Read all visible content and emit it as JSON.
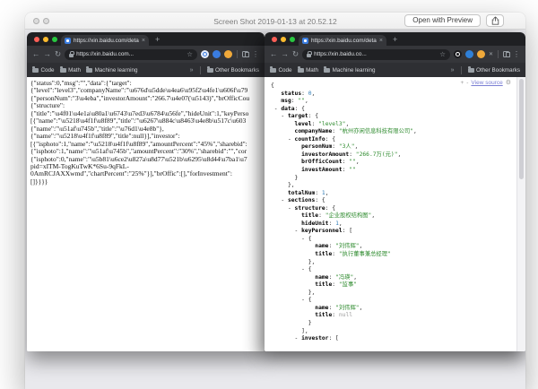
{
  "colors": {
    "traffic_red": "#ff5f57",
    "traffic_yellow": "#febc2e",
    "traffic_green": "#28c840",
    "viewer_string": "#2e8b2e",
    "viewer_number": "#2e7bb5",
    "viewer_null": "#999999",
    "view_source_link": "#7b7fd4"
  },
  "quicklook": {
    "title": "Screen Shot 2019-01-13 at 20.52.12",
    "open_button": "Open with Preview"
  },
  "browser": {
    "left": {
      "tab_title": "https://xin.baidu.com/detail/da",
      "close_glyph": "×",
      "newtab_glyph": "+",
      "back_glyph": "←",
      "forward_glyph": "→",
      "reload_glyph": "↻",
      "url": "https://xin.baidu.com...",
      "star_glyph": "☆",
      "menu_glyph": "⋮",
      "bookmarks": [
        "Code",
        "Math",
        "Machine learning"
      ],
      "overflow_glyph": "»",
      "other_bookmarks": "Other Bookmarks"
    },
    "right": {
      "tab_title": "https://xin.baidu.com/detail/da",
      "close_glyph": "×",
      "newtab_glyph": "+",
      "back_glyph": "←",
      "forward_glyph": "→",
      "reload_glyph": "↻",
      "url": "https://xin.baidu.co...",
      "star_glyph": "☆",
      "ext_x_glyph": "✕",
      "menu_glyph": "⋮",
      "bookmarks": [
        "Code",
        "Math",
        "Machine learning"
      ],
      "overflow_glyph": "»",
      "other_bookmarks": "Other Bookmarks"
    }
  },
  "raw_json": {
    "lines": [
      "{\"status\":0,\"msg\":\"\",\"data\":{\"target\":",
      "{\"level\":\"level3\",\"companyName\":\"\\u676d\\u5dde\\u4ea6\\u95f2\\u4fe1\\u606f\\u79",
      "{\"personNum\":\"3\\u4eba\",\"investorAmount\":\"266.7\\u4e07(\\u5143)\",\"brOfficCou",
      "{\"structure\":",
      "{\"title\":\"\\u4f01\\u4e1a\\u80a1\\u6743\\u7ed3\\u6784\\u56fe\",\"hideUnit\":1,\"keyPerso",
      "[{\"name\":\"\\u5218\\u4f1f\\u8f89\",\"title\":\"\\u6267\\u884c\\u8463\\u4e8b\\u517c\\u603",
      "{\"name\":\"\\u51af\\u745b\",\"title\":\"\\u76d1\\u4e8b\"},",
      "{\"name\":\"\\u5218\\u4f1f\\u8f89\",\"title\":null}],\"investor\":",
      "[{\"isphoto\":1,\"name\":\"\\u5218\\u4f1f\\u8f89\",\"amountPercent\":\"45%\",\"sharebid\":",
      "{\"isphoto\":1,\"name\":\"\\u51af\\u745b\",\"amountPercent\":\"30%\",\"sharebid\":\"\",\"cor",
      "{\"isphoto\":0,\"name\":\"\\u5b81\\u6ce2\\u827a\\u8d77\\u521b\\u6295\\u8d44\\u7ba1\\u7",
      "pid=xITM-TogKuTwK*6Su-9qFkL-",
      "0AmRCJAXXwmd\",\"chartPercent\":\"25%\"}],\"brOffic\":[],\"forInvestment\":",
      "[]}}}}"
    ]
  },
  "json_viewer": {
    "controls": {
      "expand": "+",
      "collapse": "-",
      "view_source": "View source",
      "gear_glyph": "⚙"
    },
    "lines": [
      [
        {
          "t": "{",
          "c": "p"
        }
      ],
      [
        {
          "t": "   ",
          "c": "p"
        },
        {
          "t": "status",
          "c": "k"
        },
        {
          "t": ": ",
          "c": "p"
        },
        {
          "t": "0",
          "c": "n"
        },
        {
          "t": ",",
          "c": "p"
        }
      ],
      [
        {
          "t": "   ",
          "c": "p"
        },
        {
          "t": "msg",
          "c": "k"
        },
        {
          "t": ": ",
          "c": "p"
        },
        {
          "t": "\"\"",
          "c": "s"
        },
        {
          "t": ",",
          "c": "p"
        }
      ],
      [
        {
          "t": " - ",
          "c": "p"
        },
        {
          "t": "data",
          "c": "k"
        },
        {
          "t": ": {",
          "c": "p"
        }
      ],
      [
        {
          "t": "   - ",
          "c": "p"
        },
        {
          "t": "target",
          "c": "k"
        },
        {
          "t": ": {",
          "c": "p"
        }
      ],
      [
        {
          "t": "       ",
          "c": "p"
        },
        {
          "t": "level",
          "c": "k"
        },
        {
          "t": ": ",
          "c": "p"
        },
        {
          "t": "\"level3\"",
          "c": "s"
        },
        {
          "t": ",",
          "c": "p"
        }
      ],
      [
        {
          "t": "       ",
          "c": "p"
        },
        {
          "t": "companyName",
          "c": "k"
        },
        {
          "t": ": ",
          "c": "p"
        },
        {
          "t": "\"杭州亦闲信息科技有限公司\"",
          "c": "s"
        },
        {
          "t": ",",
          "c": "p"
        }
      ],
      [
        {
          "t": "     - ",
          "c": "p"
        },
        {
          "t": "countInfo",
          "c": "k"
        },
        {
          "t": ": {",
          "c": "p"
        }
      ],
      [
        {
          "t": "         ",
          "c": "p"
        },
        {
          "t": "personNum",
          "c": "k"
        },
        {
          "t": ": ",
          "c": "p"
        },
        {
          "t": "\"3人\"",
          "c": "s"
        },
        {
          "t": ",",
          "c": "p"
        }
      ],
      [
        {
          "t": "         ",
          "c": "p"
        },
        {
          "t": "investorAmount",
          "c": "k"
        },
        {
          "t": ": ",
          "c": "p"
        },
        {
          "t": "\"266.7万(元)\"",
          "c": "s"
        },
        {
          "t": ",",
          "c": "p"
        }
      ],
      [
        {
          "t": "         ",
          "c": "p"
        },
        {
          "t": "brOfficCount",
          "c": "k"
        },
        {
          "t": ": ",
          "c": "p"
        },
        {
          "t": "\"\"",
          "c": "s"
        },
        {
          "t": ",",
          "c": "p"
        }
      ],
      [
        {
          "t": "         ",
          "c": "p"
        },
        {
          "t": "investAmount",
          "c": "k"
        },
        {
          "t": ": ",
          "c": "p"
        },
        {
          "t": "\"\"",
          "c": "s"
        }
      ],
      [
        {
          "t": "       }",
          "c": "p"
        }
      ],
      [
        {
          "t": "     },",
          "c": "p"
        }
      ],
      [
        {
          "t": "     ",
          "c": "p"
        },
        {
          "t": "totalNum",
          "c": "k"
        },
        {
          "t": ": ",
          "c": "p"
        },
        {
          "t": "1",
          "c": "n"
        },
        {
          "t": ",",
          "c": "p"
        }
      ],
      [
        {
          "t": "   - ",
          "c": "p"
        },
        {
          "t": "sections",
          "c": "k"
        },
        {
          "t": ": {",
          "c": "p"
        }
      ],
      [
        {
          "t": "     - ",
          "c": "p"
        },
        {
          "t": "structure",
          "c": "k"
        },
        {
          "t": ": {",
          "c": "p"
        }
      ],
      [
        {
          "t": "         ",
          "c": "p"
        },
        {
          "t": "title",
          "c": "k"
        },
        {
          "t": ": ",
          "c": "p"
        },
        {
          "t": "\"企业股权结构图\"",
          "c": "s"
        },
        {
          "t": ",",
          "c": "p"
        }
      ],
      [
        {
          "t": "         ",
          "c": "p"
        },
        {
          "t": "hideUnit",
          "c": "k"
        },
        {
          "t": ": ",
          "c": "p"
        },
        {
          "t": "1",
          "c": "n"
        },
        {
          "t": ",",
          "c": "p"
        }
      ],
      [
        {
          "t": "       - ",
          "c": "p"
        },
        {
          "t": "keyPersonnel",
          "c": "k"
        },
        {
          "t": ": [",
          "c": "p"
        }
      ],
      [
        {
          "t": "         - {",
          "c": "p"
        }
      ],
      [
        {
          "t": "             ",
          "c": "p"
        },
        {
          "t": "name",
          "c": "k"
        },
        {
          "t": ": ",
          "c": "p"
        },
        {
          "t": "\"刘伟辉\"",
          "c": "s"
        },
        {
          "t": ",",
          "c": "p"
        }
      ],
      [
        {
          "t": "             ",
          "c": "p"
        },
        {
          "t": "title",
          "c": "k"
        },
        {
          "t": ": ",
          "c": "p"
        },
        {
          "t": "\"执行董事兼总经理\"",
          "c": "s"
        }
      ],
      [
        {
          "t": "           },",
          "c": "p"
        }
      ],
      [
        {
          "t": "         - {",
          "c": "p"
        }
      ],
      [
        {
          "t": "             ",
          "c": "p"
        },
        {
          "t": "name",
          "c": "k"
        },
        {
          "t": ": ",
          "c": "p"
        },
        {
          "t": "\"冯瑛\"",
          "c": "s"
        },
        {
          "t": ",",
          "c": "p"
        }
      ],
      [
        {
          "t": "             ",
          "c": "p"
        },
        {
          "t": "title",
          "c": "k"
        },
        {
          "t": ": ",
          "c": "p"
        },
        {
          "t": "\"监事\"",
          "c": "s"
        }
      ],
      [
        {
          "t": "           },",
          "c": "p"
        }
      ],
      [
        {
          "t": "         - {",
          "c": "p"
        }
      ],
      [
        {
          "t": "             ",
          "c": "p"
        },
        {
          "t": "name",
          "c": "k"
        },
        {
          "t": ": ",
          "c": "p"
        },
        {
          "t": "\"刘伟辉\"",
          "c": "s"
        },
        {
          "t": ",",
          "c": "p"
        }
      ],
      [
        {
          "t": "             ",
          "c": "p"
        },
        {
          "t": "title",
          "c": "k"
        },
        {
          "t": ": ",
          "c": "p"
        },
        {
          "t": "null",
          "c": "u"
        }
      ],
      [
        {
          "t": "           }",
          "c": "p"
        }
      ],
      [
        {
          "t": "         ],",
          "c": "p"
        }
      ],
      [
        {
          "t": "       - ",
          "c": "p"
        },
        {
          "t": "investor",
          "c": "k"
        },
        {
          "t": ": [",
          "c": "p"
        }
      ]
    ]
  }
}
